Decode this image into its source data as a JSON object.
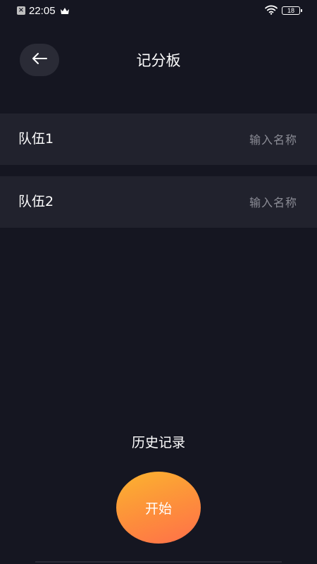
{
  "status_bar": {
    "time": "22:05",
    "battery": "18",
    "icons": [
      "close-notification-icon",
      "crown-icon",
      "wifi-icon",
      "battery-icon"
    ]
  },
  "header": {
    "title": "记分板",
    "back_icon": "arrow-left-icon"
  },
  "teams": [
    {
      "label": "队伍1",
      "placeholder": "输入名称",
      "value": ""
    },
    {
      "label": "队伍2",
      "placeholder": "输入名称",
      "value": ""
    }
  ],
  "history": {
    "label": "历史记录"
  },
  "start": {
    "label": "开始"
  },
  "colors": {
    "background": "#151621",
    "row_background": "#21222d",
    "back_button_background": "#2a2b36",
    "placeholder": "#8c8d96",
    "start_gradient_top": "#fbb42f",
    "start_gradient_bottom": "#ff6f4a"
  }
}
